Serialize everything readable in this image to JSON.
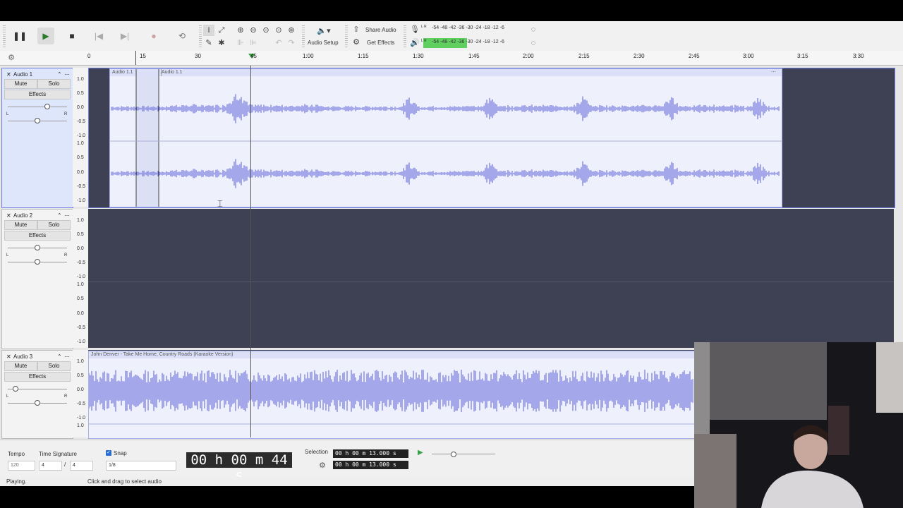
{
  "toolbar": {
    "share_audio": "Share Audio",
    "get_effects": "Get Effects",
    "audio_setup": "Audio Setup",
    "meter_scale": [
      "-54",
      "-48",
      "-42",
      "-36",
      "-30",
      "-24",
      "-18",
      "-12",
      "-6"
    ],
    "meter_record_lr": "L R",
    "meter_play_lr": "L R"
  },
  "ruler": {
    "ticks": [
      "0",
      "15",
      "30",
      "45",
      "1:00",
      "1:15",
      "1:30",
      "1:45",
      "2:00",
      "2:15",
      "2:30",
      "2:45",
      "3:00",
      "3:15",
      "3:30"
    ]
  },
  "tracks": [
    {
      "name": "Audio 1",
      "mute": "Mute",
      "solo": "Solo",
      "effects": "Effects",
      "clips": [
        "Audio 1.1",
        "Audio 1.1"
      ],
      "scale": [
        "1.0",
        "0.5",
        "0.0",
        "-0.5",
        "-1.0",
        "1.0",
        "0.5",
        "0.0",
        "-0.5",
        "-1.0"
      ],
      "pan_left": "L",
      "pan_right": "R"
    },
    {
      "name": "Audio 2",
      "mute": "Mute",
      "solo": "Solo",
      "effects": "Effects",
      "scale": [
        "1.0",
        "0.5",
        "0.0",
        "-0.5",
        "-1.0",
        "1.0",
        "0.5",
        "0.0",
        "-0.5",
        "-1.0"
      ],
      "pan_left": "L",
      "pan_right": "R"
    },
    {
      "name": "Audio 3",
      "mute": "Mute",
      "solo": "Solo",
      "effects": "Effects",
      "clip": "John Denver - Take Me Home, Country Roads (Karaoke Version)",
      "scale": [
        "1.0",
        "0.5",
        "0.0",
        "-0.5",
        "-1.0",
        "1.0"
      ],
      "pan_left": "L",
      "pan_right": "R"
    }
  ],
  "bottom": {
    "tempo_label": "Tempo",
    "tempo_value": "120",
    "time_signature_label": "Time Signature",
    "ts_num": "4",
    "ts_sep": "/",
    "ts_den": "4",
    "snap_label": "Snap",
    "snap_value": "1/8",
    "time_display": "00 h 00 m 44 s",
    "selection_label": "Selection",
    "selection_start": "00 h 00 m 13.000 s",
    "selection_end": "00 h 00 m 13.000 s"
  },
  "status": {
    "left": "Playing.",
    "right": "Click and drag to select audio"
  }
}
